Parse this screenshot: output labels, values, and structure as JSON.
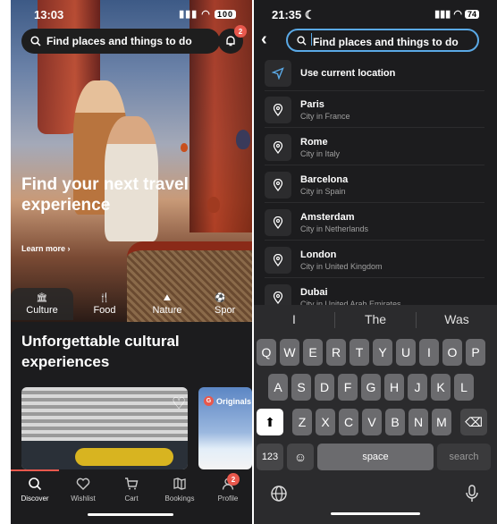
{
  "left": {
    "status": {
      "time": "13:03",
      "battery": "100"
    },
    "search": {
      "placeholder": "Find places and things to do"
    },
    "notifications": {
      "badge": "2"
    },
    "hero": {
      "title": "Find your next travel experience",
      "learn_more": "Learn more"
    },
    "categories": [
      {
        "label": "Culture",
        "icon": "museum-icon"
      },
      {
        "label": "Food",
        "icon": "utensils-icon"
      },
      {
        "label": "Nature",
        "icon": "mountain-icon"
      },
      {
        "label": "Spor",
        "icon": "sports-icon"
      }
    ],
    "section_title": "Unforgettable cultural experiences",
    "originals_label": "Originals",
    "originals_logo": "G",
    "tabs": [
      {
        "label": "Discover",
        "icon": "search-icon"
      },
      {
        "label": "Wishlist",
        "icon": "heart-icon"
      },
      {
        "label": "Cart",
        "icon": "cart-icon"
      },
      {
        "label": "Bookings",
        "icon": "map-icon"
      },
      {
        "label": "Profile",
        "icon": "profile-icon",
        "badge": "2"
      }
    ]
  },
  "right": {
    "status": {
      "time": "21:35",
      "battery": "74"
    },
    "search": {
      "placeholder": "Find places and things to do"
    },
    "current_location": "Use current location",
    "locations": [
      {
        "name": "Paris",
        "sub": "City in France"
      },
      {
        "name": "Rome",
        "sub": "City in Italy"
      },
      {
        "name": "Barcelona",
        "sub": "City in Spain"
      },
      {
        "name": "Amsterdam",
        "sub": "City in Netherlands"
      },
      {
        "name": "London",
        "sub": "City in United Kingdom"
      },
      {
        "name": "Dubai",
        "sub": "City in United Arab Emirates"
      }
    ],
    "keyboard": {
      "suggestions": [
        "I",
        "The",
        "Was"
      ],
      "row1": [
        "Q",
        "W",
        "E",
        "R",
        "T",
        "Y",
        "U",
        "I",
        "O",
        "P"
      ],
      "row2": [
        "A",
        "S",
        "D",
        "F",
        "G",
        "H",
        "J",
        "K",
        "L"
      ],
      "row3": [
        "Z",
        "X",
        "C",
        "V",
        "B",
        "N",
        "M"
      ],
      "numbers": "123",
      "space": "space",
      "search": "search"
    }
  },
  "colors": {
    "accent_red": "#e8584d",
    "search_focus": "#5aa9e6"
  }
}
